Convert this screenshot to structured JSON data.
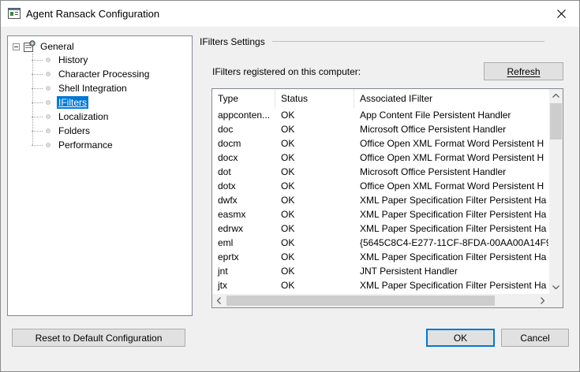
{
  "window": {
    "title": "Agent Ransack Configuration",
    "icon": "app-config-icon",
    "close_icon": "close-icon"
  },
  "tree": {
    "root_label": "General",
    "items": [
      {
        "label": "History"
      },
      {
        "label": "Character Processing"
      },
      {
        "label": "Shell Integration"
      },
      {
        "label": "IFilters",
        "selected": true
      },
      {
        "label": "Localization"
      },
      {
        "label": "Folders"
      },
      {
        "label": "Performance"
      }
    ]
  },
  "settings": {
    "group_title": "IFilters Settings",
    "registered_label": "IFilters registered on this computer:",
    "refresh_label": "Refresh"
  },
  "table": {
    "columns": [
      "Type",
      "Status",
      "Associated IFilter"
    ],
    "rows": [
      [
        "appconten...",
        "OK",
        "App Content File Persistent Handler"
      ],
      [
        "doc",
        "OK",
        "Microsoft Office Persistent Handler"
      ],
      [
        "docm",
        "OK",
        "Office Open XML Format Word Persistent H"
      ],
      [
        "docx",
        "OK",
        "Office Open XML Format Word Persistent H"
      ],
      [
        "dot",
        "OK",
        "Microsoft Office Persistent Handler"
      ],
      [
        "dotx",
        "OK",
        "Office Open XML Format Word Persistent H"
      ],
      [
        "dwfx",
        "OK",
        "XML Paper Specification Filter Persistent Ha"
      ],
      [
        "easmx",
        "OK",
        "XML Paper Specification Filter Persistent Ha"
      ],
      [
        "edrwx",
        "OK",
        "XML Paper Specification Filter Persistent Ha"
      ],
      [
        "eml",
        "OK",
        "{5645C8C4-E277-11CF-8FDA-00AA00A14F9"
      ],
      [
        "eprtx",
        "OK",
        "XML Paper Specification Filter Persistent Ha"
      ],
      [
        "jnt",
        "OK",
        "JNT Persistent Handler"
      ],
      [
        "jtx",
        "OK",
        "XML Paper Specification Filter Persistent Ha"
      ]
    ]
  },
  "footer": {
    "reset_label": "Reset to Default Configuration",
    "ok_label": "OK",
    "cancel_label": "Cancel"
  },
  "colors": {
    "selection": "#0078d7",
    "button_bg": "#e1e1e1",
    "window_bg": "#f0f0f0"
  }
}
